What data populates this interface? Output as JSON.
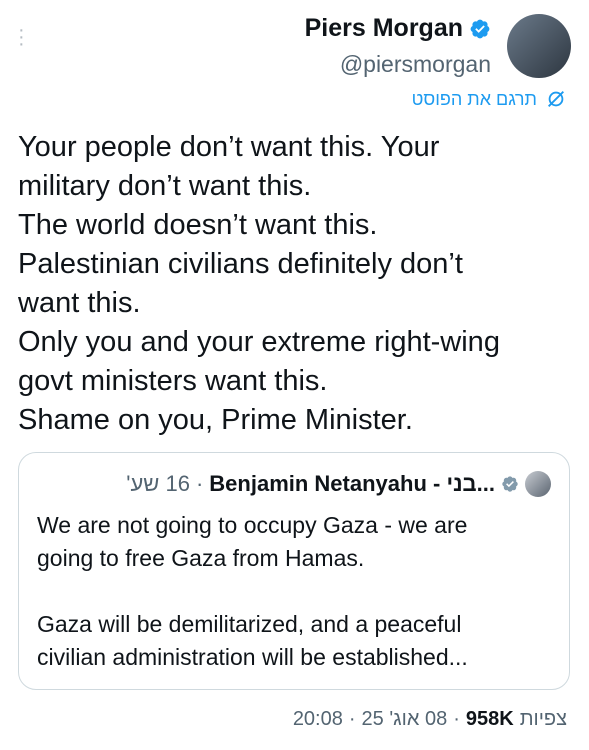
{
  "author": {
    "name": "Piers Morgan",
    "handle": "@piersmorgan"
  },
  "translate_label": "תרגם את הפוסט",
  "tweet_lines": [
    "Your people don’t want this. Your",
    "military don’t want this.",
    "The world doesn’t want this.",
    "Palestinian civilians definitely don’t",
    "want this.",
    "Only you and your extreme right-wing",
    "govt ministers want this.",
    "Shame on you, Prime Minister."
  ],
  "quote": {
    "name": "Benjamin Netanyahu - בני...",
    "time": "16 שע'",
    "separator": "·",
    "lines": [
      "We are not going to occupy Gaza - we are",
      "going to free Gaza from Hamas.",
      "",
      "Gaza will be demilitarized, and a peaceful",
      "civilian administration will be established..."
    ]
  },
  "meta": {
    "time": "20:08",
    "date": "08 אוג' 25",
    "views_count": "958K",
    "views_label": "צפיות",
    "separator": "·"
  },
  "colors": {
    "accent": "#1d9bf0",
    "text": "#0f1419",
    "muted": "#536471"
  }
}
